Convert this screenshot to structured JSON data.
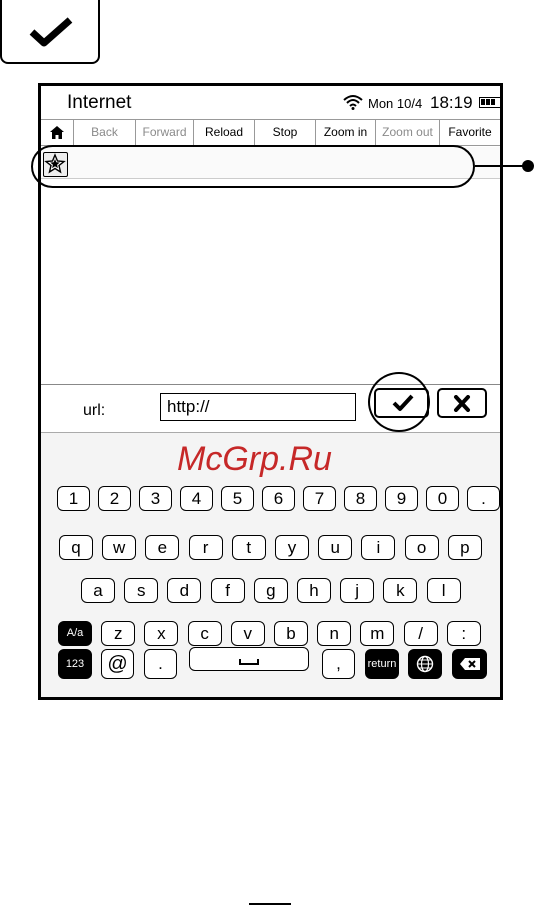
{
  "header_icon": "checkmark-icon",
  "status_bar": {
    "app_title": "Internet",
    "date": "Mon 10/4",
    "time": "18:19",
    "wifi_icon": "wifi-icon",
    "battery_icon": "battery-icon"
  },
  "toolbar": {
    "home_icon": "home-icon",
    "buttons": [
      {
        "label": "Back",
        "enabled": false
      },
      {
        "label": "Forward",
        "enabled": false
      },
      {
        "label": "Reload",
        "enabled": true
      },
      {
        "label": "Stop",
        "enabled": true
      },
      {
        "label": "Zoom in",
        "enabled": true
      },
      {
        "label": "Zoom out",
        "enabled": false
      },
      {
        "label": "Favorite",
        "enabled": true
      }
    ]
  },
  "address_bar": {
    "favorites_icon": "favorites-star-icon",
    "value": ""
  },
  "keyboard": {
    "url_label": "url:",
    "url_value": "http://",
    "ok_icon": "checkmark-icon",
    "cancel_icon": "close-icon",
    "row_digits": [
      "1",
      "2",
      "3",
      "4",
      "5",
      "6",
      "7",
      "8",
      "9",
      "0",
      "."
    ],
    "row_top": [
      "q",
      "w",
      "e",
      "r",
      "t",
      "y",
      "u",
      "i",
      "o",
      "p"
    ],
    "row_middle": [
      "a",
      "s",
      "d",
      "f",
      "g",
      "h",
      "j",
      "k",
      "l"
    ],
    "row_bottom": [
      "A/a",
      "z",
      "x",
      "c",
      "v",
      "b",
      "n",
      "m",
      "/",
      ":"
    ],
    "row_function": {
      "mode": "123",
      "at": "@",
      "dot": ".",
      "space_icon": "space-icon",
      "comma": ",",
      "return": "return",
      "globe_icon": "globe-icon",
      "backspace_icon": "backspace-icon"
    }
  },
  "watermark": "McGrp.Ru",
  "accent_colors": {
    "watermark": "#c62828"
  }
}
